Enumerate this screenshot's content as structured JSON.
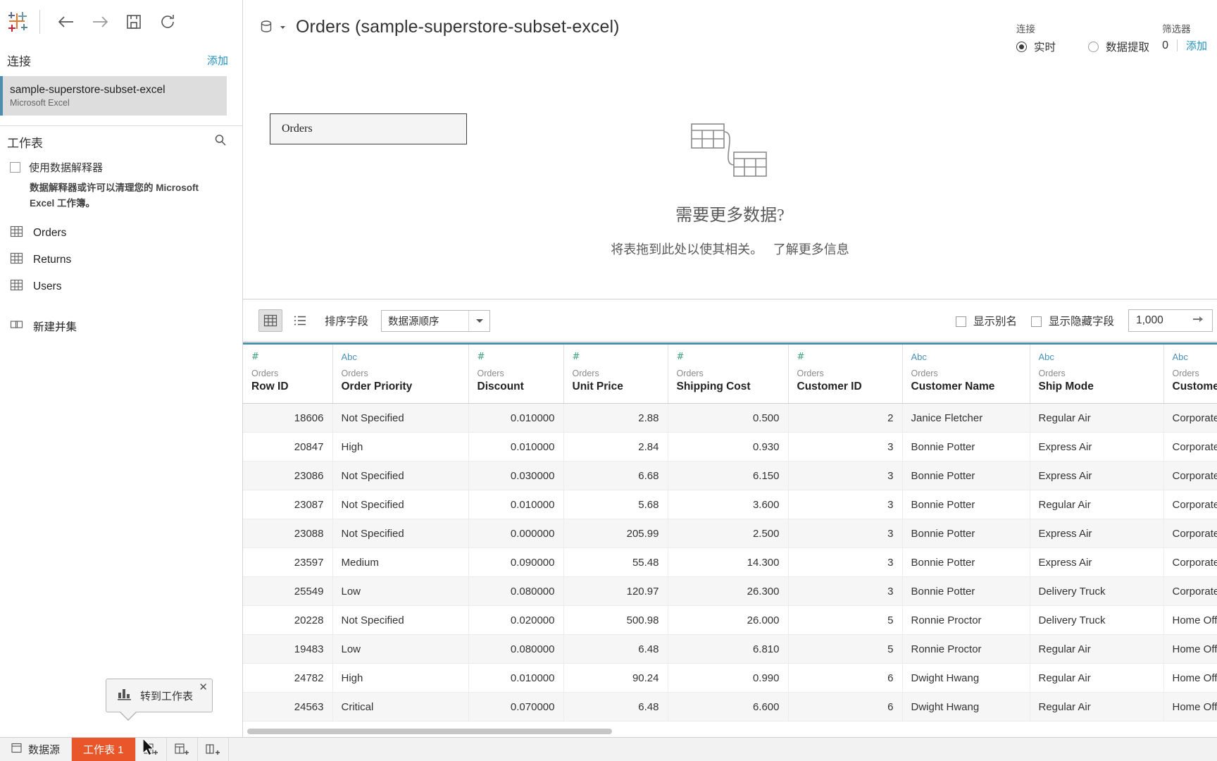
{
  "toolbar": {
    "logo": "tableau-logo",
    "back": "back-arrow-icon",
    "forward": "forward-arrow-icon",
    "save": "save-icon",
    "refresh": "refresh-icon"
  },
  "left_panel": {
    "connections_title": "连接",
    "connections_add": "添加",
    "connection": {
      "name": "sample-superstore-subset-excel",
      "type": "Microsoft Excel"
    },
    "sheets_title": "工作表",
    "search_icon": "search-icon",
    "data_interpreter": {
      "label": "使用数据解释器",
      "checked": false,
      "description": "数据解释器或许可以清理您的 Microsoft Excel 工作簿。"
    },
    "tables": [
      "Orders",
      "Returns",
      "Users"
    ],
    "new_union": "新建并集"
  },
  "canvas": {
    "title": "Orders (sample-superstore-subset-excel)",
    "db_icon": "database-icon",
    "table_node": "Orders",
    "connection_mode": {
      "label": "连接",
      "options": [
        {
          "label": "实时",
          "selected": true
        },
        {
          "label": "数据提取",
          "selected": false
        }
      ]
    },
    "filters": {
      "label": "筛选器",
      "count": "0",
      "add": "添加"
    },
    "need_more": {
      "title": "需要更多数据?",
      "subtitle": "将表拖到此处以使其相关。",
      "link": "了解更多信息"
    }
  },
  "grid_toolbar": {
    "grid_view_icon": "grid-view-icon",
    "list_view_icon": "list-view-icon",
    "sort_label": "排序字段",
    "sort_value": "数据源顺序",
    "show_aliases": {
      "label": "显示别名",
      "checked": false
    },
    "show_hidden": {
      "label": "显示隐藏字段",
      "checked": false
    },
    "row_limit": "1,000",
    "row_limit_go": "arrow-right-icon"
  },
  "grid": {
    "columns": [
      {
        "type": "#",
        "type_kind": "num",
        "table": "Orders",
        "name": "Row ID"
      },
      {
        "type": "Abc",
        "type_kind": "str",
        "table": "Orders",
        "name": "Order Priority"
      },
      {
        "type": "#",
        "type_kind": "num",
        "table": "Orders",
        "name": "Discount"
      },
      {
        "type": "#",
        "type_kind": "num",
        "table": "Orders",
        "name": "Unit Price"
      },
      {
        "type": "#",
        "type_kind": "num",
        "table": "Orders",
        "name": "Shipping Cost"
      },
      {
        "type": "#",
        "type_kind": "num",
        "table": "Orders",
        "name": "Customer ID"
      },
      {
        "type": "Abc",
        "type_kind": "str",
        "table": "Orders",
        "name": "Customer Name"
      },
      {
        "type": "Abc",
        "type_kind": "str",
        "table": "Orders",
        "name": "Ship Mode"
      },
      {
        "type": "Abc",
        "type_kind": "str",
        "table": "Orders",
        "name": "Customer Segment"
      }
    ],
    "rows": [
      [
        "18606",
        "Not Specified",
        "0.010000",
        "2.88",
        "0.500",
        "2",
        "Janice Fletcher",
        "Regular Air",
        "Corporate"
      ],
      [
        "20847",
        "High",
        "0.010000",
        "2.84",
        "0.930",
        "3",
        "Bonnie Potter",
        "Express Air",
        "Corporate"
      ],
      [
        "23086",
        "Not Specified",
        "0.030000",
        "6.68",
        "6.150",
        "3",
        "Bonnie Potter",
        "Express Air",
        "Corporate"
      ],
      [
        "23087",
        "Not Specified",
        "0.010000",
        "5.68",
        "3.600",
        "3",
        "Bonnie Potter",
        "Regular Air",
        "Corporate"
      ],
      [
        "23088",
        "Not Specified",
        "0.000000",
        "205.99",
        "2.500",
        "3",
        "Bonnie Potter",
        "Express Air",
        "Corporate"
      ],
      [
        "23597",
        "Medium",
        "0.090000",
        "55.48",
        "14.300",
        "3",
        "Bonnie Potter",
        "Express Air",
        "Corporate"
      ],
      [
        "25549",
        "Low",
        "0.080000",
        "120.97",
        "26.300",
        "3",
        "Bonnie Potter",
        "Delivery Truck",
        "Corporate"
      ],
      [
        "20228",
        "Not Specified",
        "0.020000",
        "500.98",
        "26.000",
        "5",
        "Ronnie Proctor",
        "Delivery Truck",
        "Home Office"
      ],
      [
        "19483",
        "Low",
        "0.080000",
        "6.48",
        "6.810",
        "5",
        "Ronnie Proctor",
        "Regular Air",
        "Home Office"
      ],
      [
        "24782",
        "High",
        "0.010000",
        "90.24",
        "0.990",
        "6",
        "Dwight Hwang",
        "Regular Air",
        "Home Office"
      ],
      [
        "24563",
        "Critical",
        "0.070000",
        "6.48",
        "6.600",
        "6",
        "Dwight Hwang",
        "Regular Air",
        "Home Office"
      ]
    ]
  },
  "bottom_bar": {
    "data_source_tab": "数据源",
    "sheet_tab": "工作表 1",
    "new_sheet_icon": "new-worksheet-icon",
    "new_dashboard_icon": "new-dashboard-icon",
    "new_story_icon": "new-story-icon"
  },
  "tooltip": {
    "text": "转到工作表",
    "icon": "bar-chart-icon",
    "close": "✕"
  },
  "colors": {
    "accent_blue": "#4e8fad",
    "link_blue": "#1f8fbf",
    "active_tab_orange": "#e8562a",
    "numeric_green": "#3fa37a",
    "string_blue": "#4a90b8"
  }
}
